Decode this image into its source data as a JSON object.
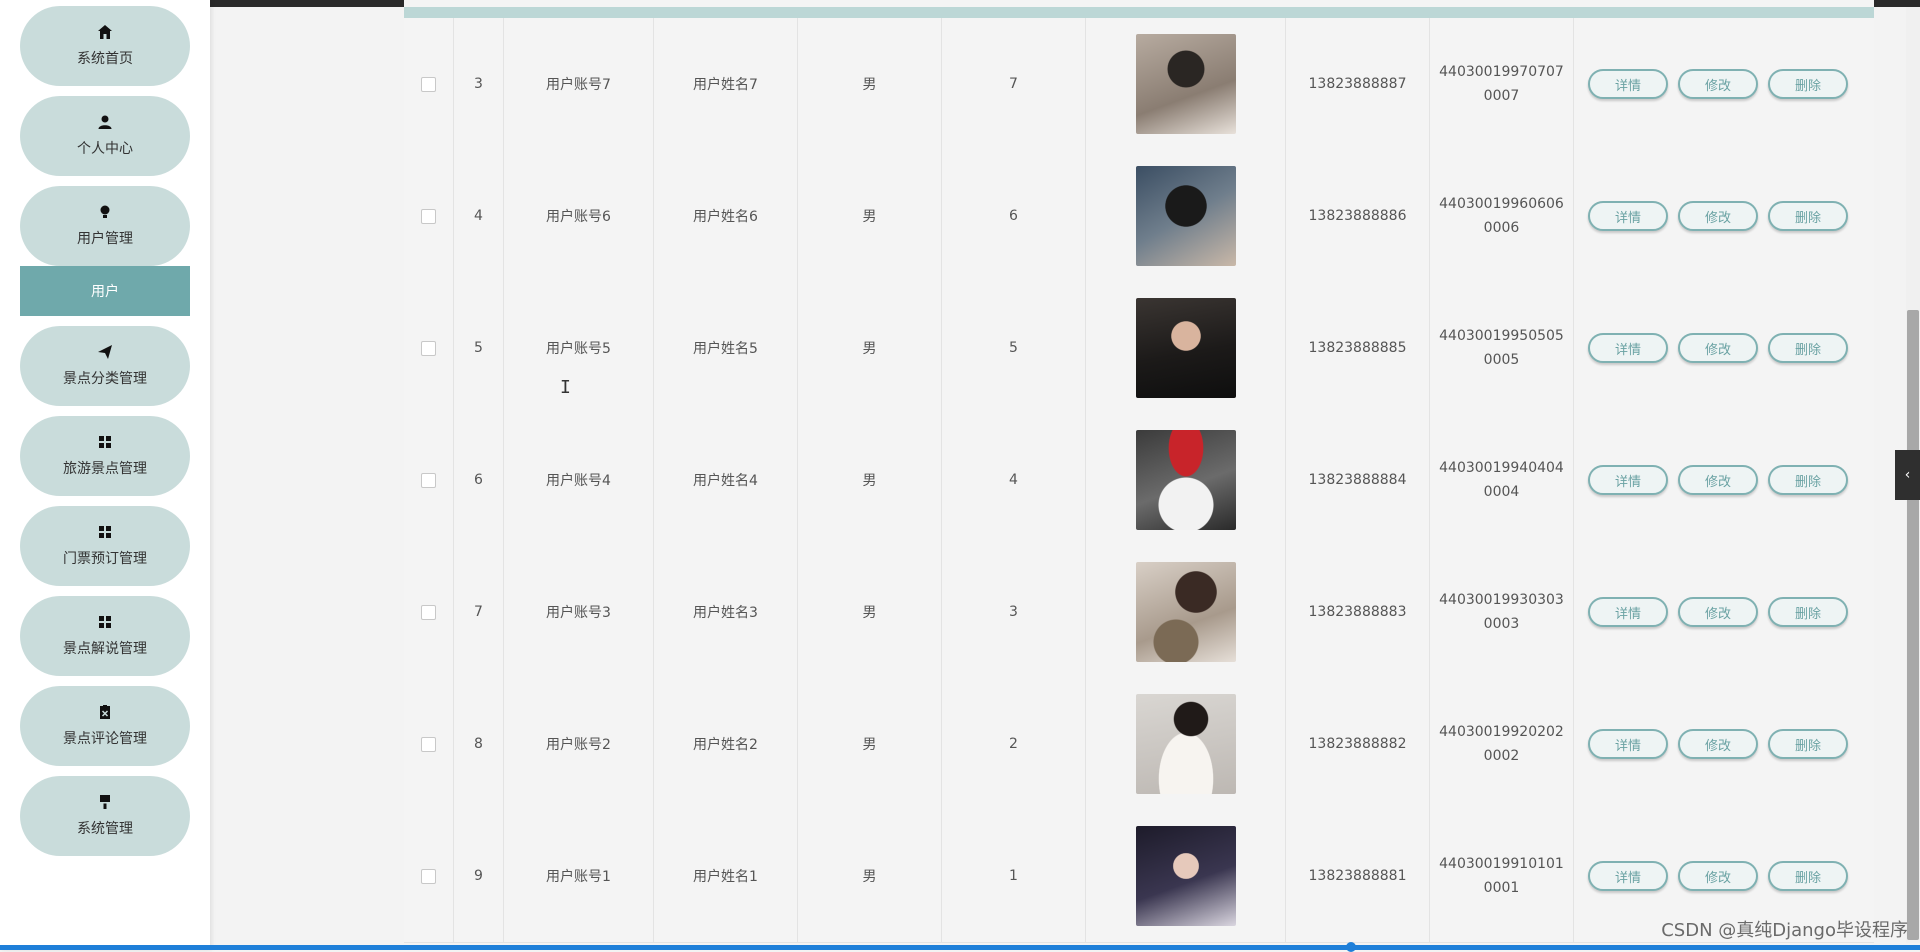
{
  "sidebar": {
    "items": [
      {
        "label": "系统首页",
        "icon": "home-icon"
      },
      {
        "label": "个人中心",
        "icon": "person-icon"
      },
      {
        "label": "用户管理",
        "icon": "bulb-icon"
      },
      {
        "label": "景点分类管理",
        "icon": "send-icon"
      },
      {
        "label": "旅游景点管理",
        "icon": "grid-icon"
      },
      {
        "label": "门票预订管理",
        "icon": "grid-icon"
      },
      {
        "label": "景点解说管理",
        "icon": "grid-icon"
      },
      {
        "label": "景点评论管理",
        "icon": "clipboard-icon"
      },
      {
        "label": "系统管理",
        "icon": "brush-icon"
      }
    ],
    "active_submenu": "用户"
  },
  "table": {
    "rows": [
      {
        "idx": "3",
        "account": "用户账号7",
        "name": "用户姓名7",
        "sex": "男",
        "age": "7",
        "phone": "13823888887",
        "id_card": "440300199707070007"
      },
      {
        "idx": "4",
        "account": "用户账号6",
        "name": "用户姓名6",
        "sex": "男",
        "age": "6",
        "phone": "13823888886",
        "id_card": "440300199606060006"
      },
      {
        "idx": "5",
        "account": "用户账号5",
        "name": "用户姓名5",
        "sex": "男",
        "age": "5",
        "phone": "13823888885",
        "id_card": "440300199505050005"
      },
      {
        "idx": "6",
        "account": "用户账号4",
        "name": "用户姓名4",
        "sex": "男",
        "age": "4",
        "phone": "13823888884",
        "id_card": "440300199404040004"
      },
      {
        "idx": "7",
        "account": "用户账号3",
        "name": "用户姓名3",
        "sex": "男",
        "age": "3",
        "phone": "13823888883",
        "id_card": "440300199303030003"
      },
      {
        "idx": "8",
        "account": "用户账号2",
        "name": "用户姓名2",
        "sex": "男",
        "age": "2",
        "phone": "13823888882",
        "id_card": "440300199202020002"
      },
      {
        "idx": "9",
        "account": "用户账号1",
        "name": "用户姓名1",
        "sex": "男",
        "age": "1",
        "phone": "13823888881",
        "id_card": "440300199101010001"
      }
    ],
    "actions": {
      "detail": "详情",
      "edit": "修改",
      "delete": "删除"
    }
  },
  "watermark": "CSDN @真纯Django毕设程序",
  "colors": {
    "accent": "#6fa9ab",
    "menu_bg": "#c9dcdb",
    "header_strip": "#bcd7d6"
  }
}
